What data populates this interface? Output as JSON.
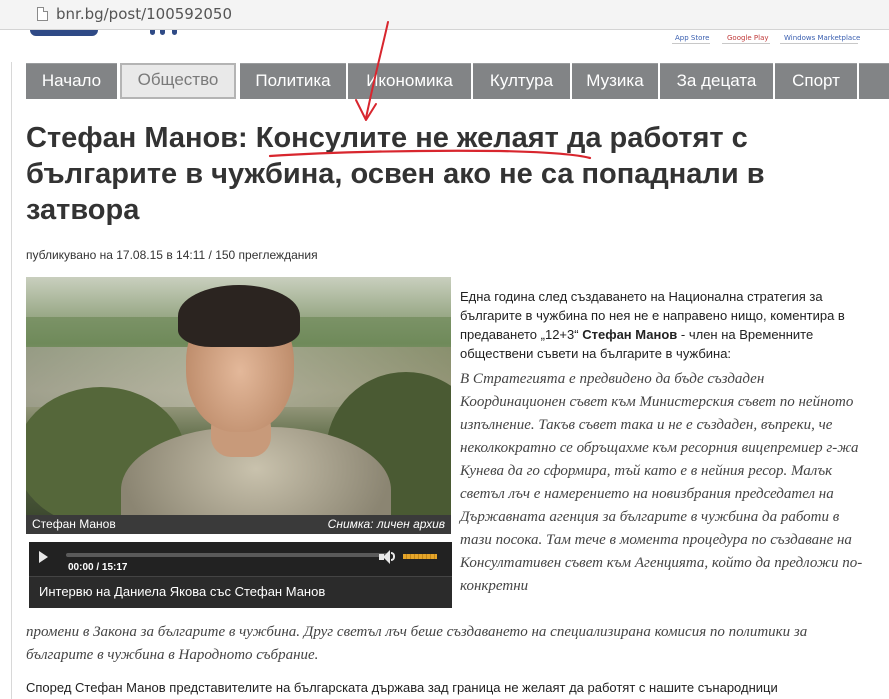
{
  "browser": {
    "url": "bnr.bg/post/100592050"
  },
  "header": {
    "store_links": [
      "App Store",
      "Google Play",
      "Windows Marketplace"
    ]
  },
  "nav": {
    "items": [
      "Начало",
      "Общество",
      "Политика",
      "Икономика",
      "Култура",
      "Музика",
      "За децата",
      "Спорт"
    ],
    "active": "Общество"
  },
  "article": {
    "title": "Стефан Манов: Консулите не желаят да работят с българите в чужбина, освен ако не са попаднали в затвора",
    "meta": {
      "published_prefix": "публикувано на",
      "date": "17.08.15",
      "time_prefix": "в",
      "time": "14:11",
      "views": "150 преглеждания"
    },
    "photo": {
      "caption_left": "Стефан Манов",
      "caption_right": "Снимка: личен архив"
    },
    "player": {
      "time": "00:00 / 15:17",
      "title": "Интервю на Даниела Якова със Стефан Манов",
      "progress": 0
    },
    "lead_before": "Една година след създаването на Национална стратегия за българите в чужбина по нея не е направено нищо, коментира в предаването „12+3“",
    "lead_name": "Стефан Манов",
    "lead_after": "- член на Временните обществени съвети на българите в чужбина:",
    "quote_part1": "В Стратегията е предвидено да бъде създаден Координационен съвет към Министерския съвет по нейното изпълнение. Такъв съвет така и не е създаден, въпреки, че неколкократно се обръщахме към ресорния вицепремиер г-жа Кунева да го сформира, тъй като е в нейния ресор. Малък светъл лъч е намерението на новизбрания председател на Държавната агенция за българите в чужбина да работи в тази посока. Там тече в момента процедура по създаване на Консултативен съвет към Агенцията, който да предложи по-конкретни",
    "quote_part2": "промени в Закона за българите в чужбина. Друг светъл лъч беше създаването на специализирана комисия по политики за българите в чужбина в Народното събрание.",
    "last_paragraph": "Според Стефан Манов представителите на българската държава зад граница не желаят да работят с нашите сънародници"
  },
  "colors": {
    "nav_bg": "#828486",
    "annotation_red": "#d8262e",
    "player_bg": "#2b2b2b",
    "volume_orange": "#e5a52a"
  }
}
